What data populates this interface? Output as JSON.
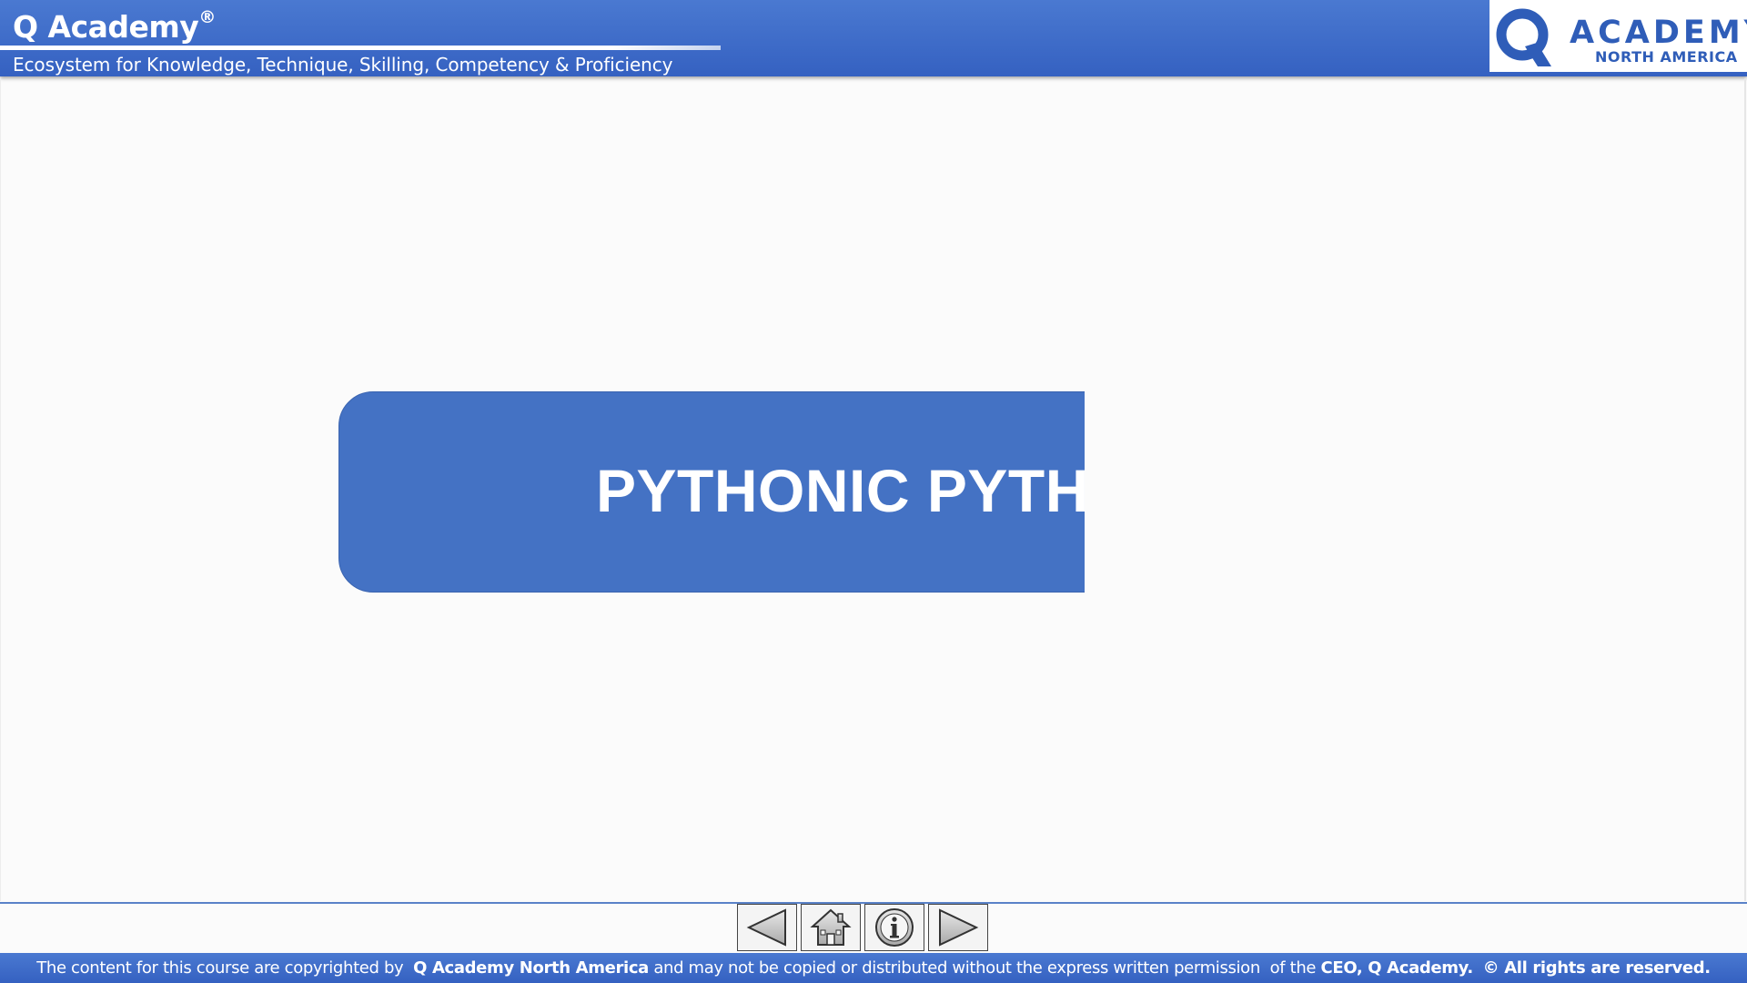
{
  "header": {
    "brand": "Q Academy",
    "brand_mark": "®",
    "tagline": "Ecosystem for Knowledge, Technique, Skilling, Competency & Proficiency",
    "logo": {
      "icon": "q-logo-icon",
      "word": "ACADEMY",
      "sub": "NORTH AMERICA"
    }
  },
  "slide": {
    "title": "PYTHONIC PYTHON"
  },
  "nav": {
    "buttons": [
      {
        "name": "previous-button",
        "icon": "triangle-left-icon"
      },
      {
        "name": "home-button",
        "icon": "house-icon"
      },
      {
        "name": "info-button",
        "icon": "info-icon"
      },
      {
        "name": "next-button",
        "icon": "triangle-right-icon"
      }
    ]
  },
  "footer": {
    "part1": "The content for this course are copyrighted by",
    "org": "Q Academy North America",
    "part2": "and may not be copied or distributed without the express written permission",
    "part3": "of the",
    "ceo": "CEO, Q Academy.",
    "rights": "© All rights are reserved."
  },
  "colors": {
    "header_blue": "#3f6dcb",
    "card_blue": "#4472c4",
    "logo_blue": "#2f5db8"
  }
}
